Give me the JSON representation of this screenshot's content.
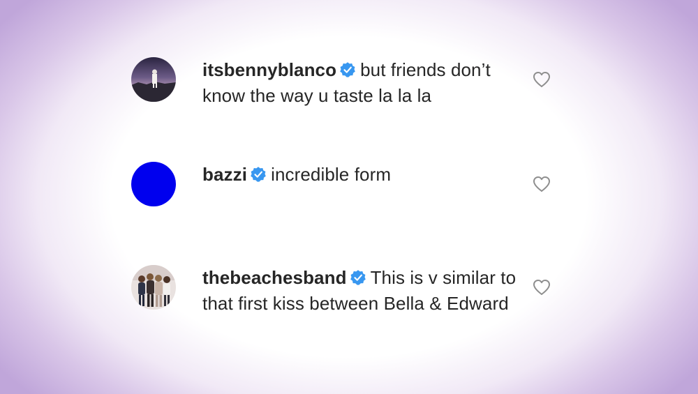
{
  "comments": [
    {
      "username": "itsbennyblanco",
      "verified": true,
      "text": "but friends don’t know the way u taste la la la",
      "avatar": "photo-dusk-figure",
      "like_icon": "heart-outline-icon"
    },
    {
      "username": "bazzi",
      "verified": true,
      "text": "incredible form",
      "avatar": "solid-blue-circle",
      "avatar_color": "#0000ee",
      "like_icon": "heart-outline-icon"
    },
    {
      "username": "thebeachesband",
      "verified": true,
      "text": "This is v similar to that first kiss between Bella & Edward",
      "avatar": "photo-band-group",
      "like_icon": "heart-outline-icon"
    }
  ],
  "colors": {
    "text": "#262626",
    "verified_badge": "#3897f0",
    "heart_outline": "#8e8e8e",
    "vignette": "#c0a6da"
  }
}
